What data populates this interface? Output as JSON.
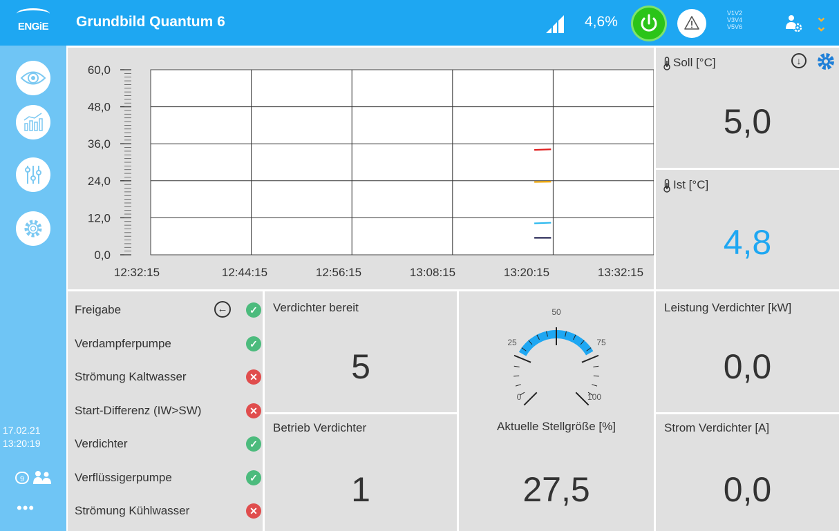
{
  "header": {
    "brand": "ENGiE",
    "title": "Grundbild Quantum 6",
    "percent": "4,6%",
    "phases": [
      "V1V2",
      "V3V4",
      "V5V6"
    ],
    "accent_color": "#1ea7f2",
    "power_color": "#2bc418",
    "icons": [
      "signal-icon",
      "power-icon",
      "warning-icon",
      "user-settings-icon",
      "chevron-down-icon"
    ]
  },
  "sidebar": {
    "items": [
      "eye-icon",
      "chart-icon",
      "sliders-icon",
      "gear-icon"
    ],
    "date": "17.02.21",
    "time": "13:20:19",
    "user_count": "9",
    "more": "•••"
  },
  "chart_data": {
    "type": "line",
    "x_labels": [
      "12:32:15",
      "12:44:15",
      "12:56:15",
      "13:08:15",
      "13:20:15",
      "13:32:15"
    ],
    "y_labels": [
      "60,0",
      "48,0",
      "36,0",
      "24,0",
      "12,0",
      "0,0"
    ],
    "ylim": [
      0,
      60
    ],
    "grid": true,
    "series": [
      {
        "color": "#e02020",
        "x": [
          "13:18:00",
          "13:20:00"
        ],
        "y": [
          34.0,
          34.2
        ]
      },
      {
        "color": "#f0a500",
        "x": [
          "13:18:00",
          "13:20:00"
        ],
        "y": [
          23.6,
          23.7
        ]
      },
      {
        "color": "#2ab8ee",
        "x": [
          "13:18:00",
          "13:20:00"
        ],
        "y": [
          10.2,
          10.4
        ]
      },
      {
        "color": "#1a1a4a",
        "x": [
          "13:18:00",
          "13:20:00"
        ],
        "y": [
          5.5,
          5.5
        ]
      }
    ]
  },
  "soll": {
    "label": "Soll [°C]",
    "value": "5,0"
  },
  "ist": {
    "label": "Ist [°C]",
    "value": "4,8",
    "value_color": "#1ea7f2"
  },
  "status": [
    {
      "label": "Freigabe",
      "state": "ok"
    },
    {
      "label": "Verdampferpumpe",
      "state": "ok"
    },
    {
      "label": "Strömung Kaltwasser",
      "state": "bad"
    },
    {
      "label": "Start-Differenz (IW>SW)",
      "state": "bad"
    },
    {
      "label": "Verdichter",
      "state": "ok"
    },
    {
      "label": "Verflüssigerpumpe",
      "state": "ok"
    },
    {
      "label": "Strömung Kühlwasser",
      "state": "bad"
    }
  ],
  "verdichter_bereit": {
    "label": "Verdichter bereit",
    "value": "5"
  },
  "betrieb_verdichter": {
    "label": "Betrieb Verdichter",
    "value": "1"
  },
  "gauge": {
    "min_label": "0",
    "l25": "25",
    "l50": "50",
    "l75": "75",
    "max_label": "100",
    "value": 27.5
  },
  "stellgroesse": {
    "label": "Aktuelle Stellgröße [%]",
    "value": "27,5"
  },
  "leistung": {
    "label": "Leistung Verdichter [kW]",
    "value": "0,0"
  },
  "strom": {
    "label": "Strom Verdichter [A]",
    "value": "0,0"
  }
}
